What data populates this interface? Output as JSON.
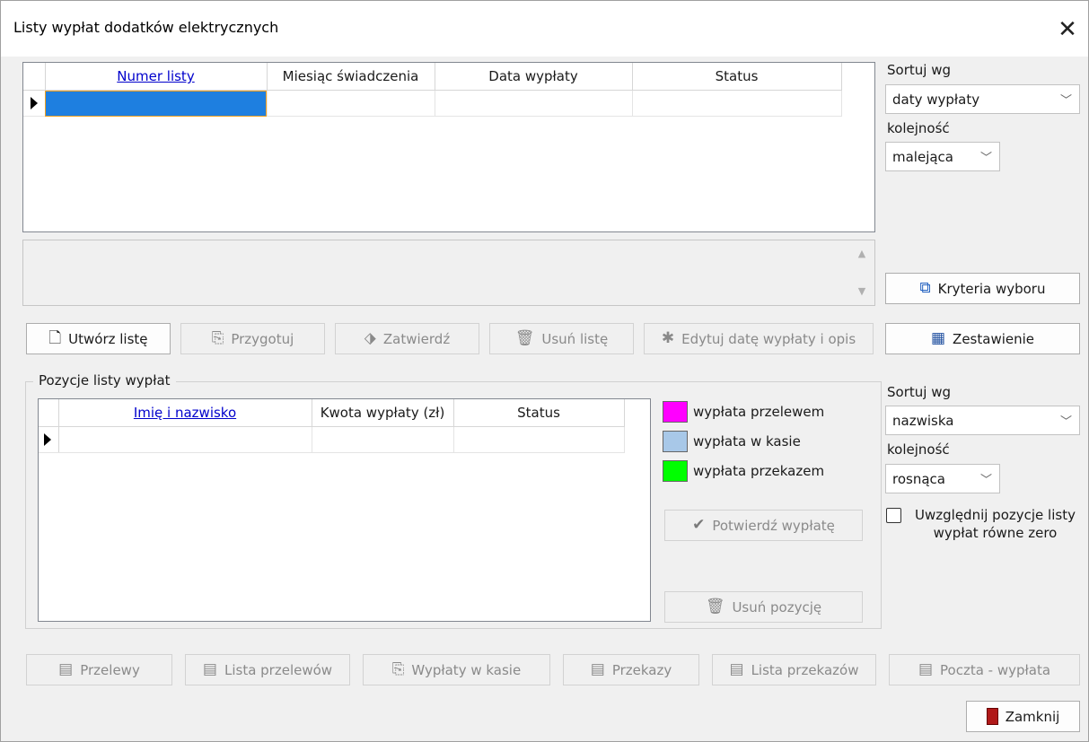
{
  "window": {
    "title": "Listy wypłat dodatków elektrycznych",
    "close": "✕"
  },
  "lists_grid": {
    "columns": [
      "Numer listy",
      "Miesiąc świadczenia",
      "Data wypłaty",
      "Status"
    ],
    "sort_column": "Numer listy"
  },
  "list_sort": {
    "sort_label": "Sortuj wg",
    "sort_value": "daty wypłaty",
    "order_label": "kolejność",
    "order_value": "malejąca"
  },
  "buttons_top": {
    "criteria": "Kryteria wyboru",
    "create": "Utwórz listę",
    "prepare": "Przygotuj",
    "approve": "Zatwierdź",
    "delete": "Usuń listę",
    "edit_date": "Edytuj datę wypłaty i opis",
    "summary": "Zestawienie"
  },
  "items_group": {
    "title": "Pozycje listy wypłat",
    "columns": [
      "Imię i nazwisko",
      "Kwota wypłaty (zł)",
      "Status"
    ]
  },
  "legend": [
    {
      "label": "wypłata przelewem",
      "color": "#ff00ff"
    },
    {
      "label": "wypłata w kasie",
      "color": "#a8c8e8"
    },
    {
      "label": "wypłata przekazem",
      "color": "#00ff00"
    }
  ],
  "items_buttons": {
    "confirm": "Potwierdź wypłatę",
    "remove": "Usuń pozycję"
  },
  "items_sort": {
    "sort_label": "Sortuj wg",
    "sort_value": "nazwiska",
    "order_label": "kolejność",
    "order_value": "rosnąca",
    "include_zero": "Uwzględnij pozycje listy wypłat równe zero"
  },
  "bottom_buttons": {
    "transfers": "Przelewy",
    "transfer_list": "Lista przelewów",
    "cash": "Wypłaty w kasie",
    "money_orders": "Przekazy",
    "money_order_list": "Lista przekazów",
    "post": "Poczta - wypłata",
    "close": "Zamknij"
  }
}
